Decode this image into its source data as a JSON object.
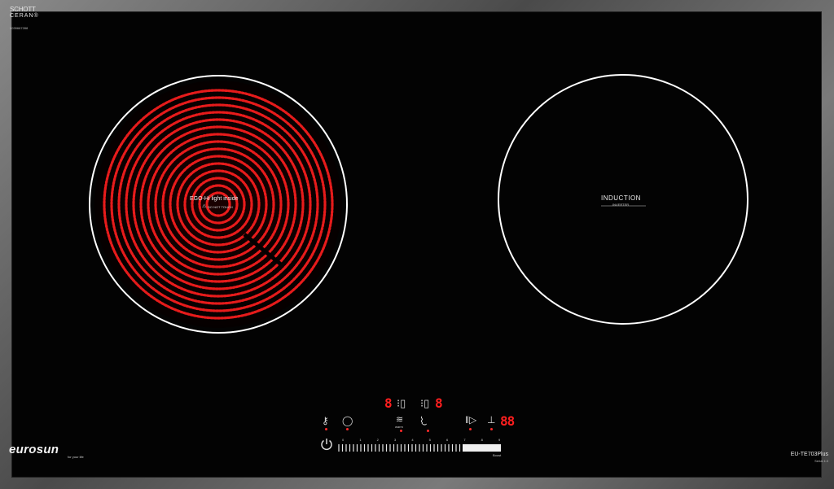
{
  "brand": {
    "line1": "SCHOTT",
    "line2": "CERAN®",
    "serial": "6039667288"
  },
  "left_zone": {
    "line1": "EGO-Hi light inside",
    "line2": "DO NOT TOUCH",
    "glow_color": "#ff1e1e"
  },
  "right_zone": {
    "line1": "INDUCTION",
    "line2": "INVERTER",
    "ring_color": "#ffffff"
  },
  "controls": {
    "left_display": "8",
    "right_display": "8",
    "timer_display": "88",
    "warm_label": "warm",
    "slider_numbers": [
      "0",
      "1",
      "2",
      "3",
      "4",
      "5",
      "6",
      "7",
      "8",
      "9"
    ],
    "slider_end_label": "Boost"
  },
  "footer": {
    "logo": "eurosun",
    "tagline": "for your life",
    "model": "EU-TE703Plus",
    "series": "Serial 4.0"
  },
  "colors": {
    "display": "#ff1f1f",
    "glass": "#030303",
    "frame": "#6b6b6b"
  }
}
